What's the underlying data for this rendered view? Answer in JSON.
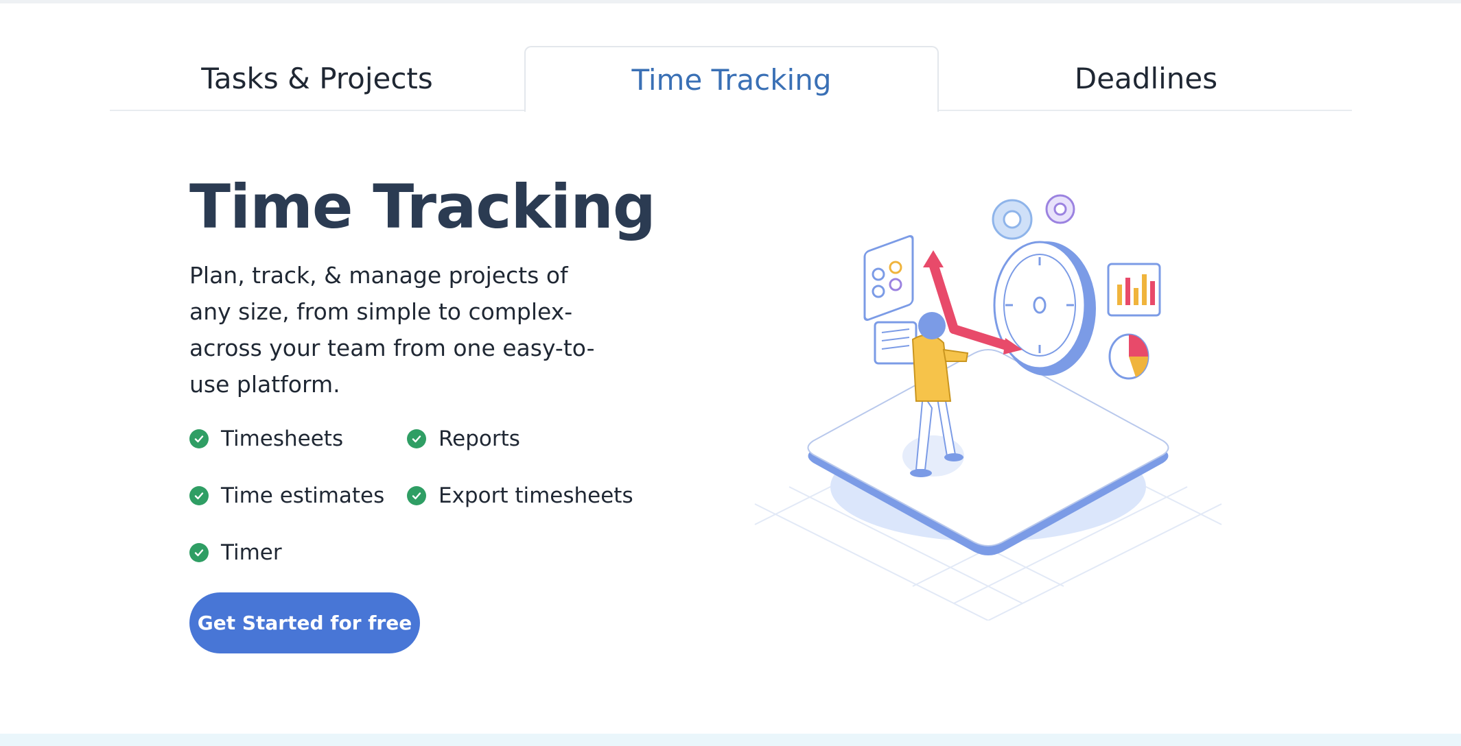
{
  "tabs": [
    {
      "label": "Tasks & Projects",
      "active": false
    },
    {
      "label": "Time Tracking",
      "active": true
    },
    {
      "label": "Deadlines",
      "active": false
    }
  ],
  "content": {
    "title": "Time Tracking",
    "description": "Plan, track, & manage projects of any size, from simple to complex- across your team from one easy-to-use platform.",
    "features": [
      "Timesheets",
      "Reports",
      "Time estimates",
      "Export timesheets",
      "Timer"
    ],
    "cta_label": "Get Started for free"
  },
  "colors": {
    "accent": "#4876d6",
    "active_tab_text": "#3a70b5",
    "heading": "#2b3b52",
    "check": "#2f9e64"
  },
  "illustration": {
    "icons": [
      "gear-icon",
      "stopwatch-icon",
      "bar-chart-icon",
      "pie-chart-icon",
      "dashboard-panel-icon",
      "document-icon"
    ]
  }
}
